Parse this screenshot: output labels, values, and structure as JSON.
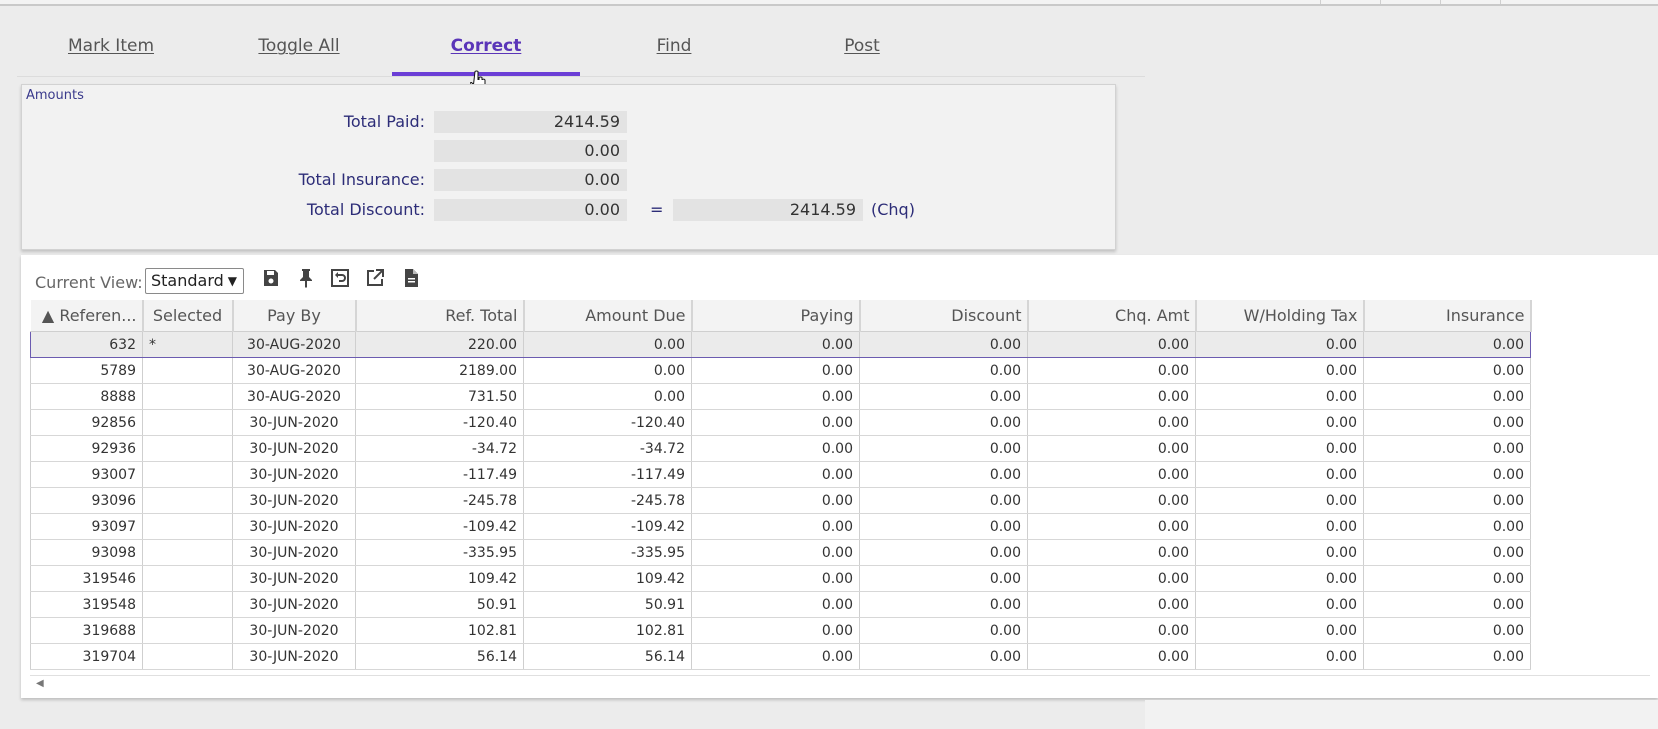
{
  "toolbar": {
    "tabs": [
      {
        "label": "Mark Item"
      },
      {
        "label": "Toggle All"
      },
      {
        "label": "Correct"
      },
      {
        "label": "Find"
      },
      {
        "label": "Post"
      }
    ]
  },
  "amounts": {
    "title": "Amounts",
    "total_paid_label": "Total Paid:",
    "total_paid": "2414.59",
    "second_value": "0.00",
    "total_insurance_label": "Total Insurance:",
    "total_insurance": "0.00",
    "total_discount_label": "Total Discount:",
    "total_discount": "0.00",
    "equals": "=",
    "cheque_total": "2414.59",
    "cheque_suffix": "(Chq)"
  },
  "view": {
    "label": "Current View:",
    "selected": "Standard",
    "icons": [
      "save-icon",
      "pin-icon",
      "reset-icon",
      "export-icon",
      "document-icon"
    ]
  },
  "grid": {
    "columns": [
      "▲ Referen...",
      "Selected",
      "Pay By",
      "Ref. Total",
      "Amount Due",
      "Paying",
      "Discount",
      "Chq. Amt",
      "W/Holding Tax",
      "Insurance"
    ],
    "rows": [
      [
        "632",
        "*",
        "30-AUG-2020",
        "220.00",
        "0.00",
        "0.00",
        "0.00",
        "0.00",
        "0.00",
        "0.00"
      ],
      [
        "5789",
        "",
        "30-AUG-2020",
        "2189.00",
        "0.00",
        "0.00",
        "0.00",
        "0.00",
        "0.00",
        "0.00"
      ],
      [
        "8888",
        "",
        "30-AUG-2020",
        "731.50",
        "0.00",
        "0.00",
        "0.00",
        "0.00",
        "0.00",
        "0.00"
      ],
      [
        "92856",
        "",
        "30-JUN-2020",
        "-120.40",
        "-120.40",
        "0.00",
        "0.00",
        "0.00",
        "0.00",
        "0.00"
      ],
      [
        "92936",
        "",
        "30-JUN-2020",
        "-34.72",
        "-34.72",
        "0.00",
        "0.00",
        "0.00",
        "0.00",
        "0.00"
      ],
      [
        "93007",
        "",
        "30-JUN-2020",
        "-117.49",
        "-117.49",
        "0.00",
        "0.00",
        "0.00",
        "0.00",
        "0.00"
      ],
      [
        "93096",
        "",
        "30-JUN-2020",
        "-245.78",
        "-245.78",
        "0.00",
        "0.00",
        "0.00",
        "0.00",
        "0.00"
      ],
      [
        "93097",
        "",
        "30-JUN-2020",
        "-109.42",
        "-109.42",
        "0.00",
        "0.00",
        "0.00",
        "0.00",
        "0.00"
      ],
      [
        "93098",
        "",
        "30-JUN-2020",
        "-335.95",
        "-335.95",
        "0.00",
        "0.00",
        "0.00",
        "0.00",
        "0.00"
      ],
      [
        "319546",
        "",
        "30-JUN-2020",
        "109.42",
        "109.42",
        "0.00",
        "0.00",
        "0.00",
        "0.00",
        "0.00"
      ],
      [
        "319548",
        "",
        "30-JUN-2020",
        "50.91",
        "50.91",
        "0.00",
        "0.00",
        "0.00",
        "0.00",
        "0.00"
      ],
      [
        "319688",
        "",
        "30-JUN-2020",
        "102.81",
        "102.81",
        "0.00",
        "0.00",
        "0.00",
        "0.00",
        "0.00"
      ],
      [
        "319704",
        "",
        "30-JUN-2020",
        "56.14",
        "56.14",
        "0.00",
        "0.00",
        "0.00",
        "0.00",
        "0.00"
      ]
    ]
  },
  "colors": {
    "accent": "#6b3ed6",
    "active_tab_text": "#5a35b8",
    "label_text": "#2d2d78",
    "selected_row_border": "#6b5bb0"
  }
}
